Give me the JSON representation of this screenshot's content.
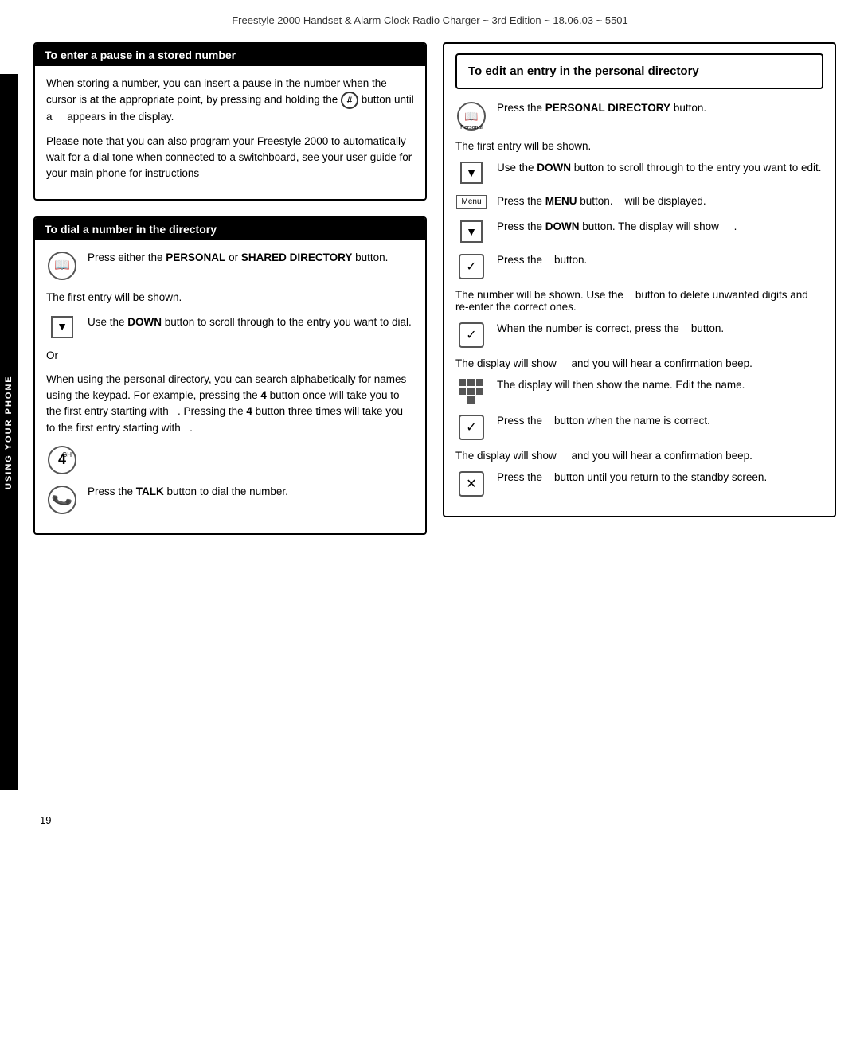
{
  "header": {
    "title": "Freestyle 2000 Handset & Alarm Clock Radio Charger  ~ 3rd Edition ~ 18.06.03 ~ 5501"
  },
  "sidebar": {
    "label": "USING YOUR PHONE"
  },
  "left": {
    "section1": {
      "title": "To enter a pause in a stored number",
      "paragraphs": [
        "When storing a number, you can insert a pause in the number when the cursor is at the appropriate point, by pressing and holding the",
        "button until a    appears in the display.",
        "Please note that you can also program your Freestyle 2000 to automatically wait for a dial tone when connected to a switchboard, see your user guide for your main phone for instructions"
      ]
    },
    "section2": {
      "title": "To dial a number in the directory",
      "rows": [
        {
          "icon": "book",
          "text": "Press either the PERSONAL or SHARED DIRECTORY button.",
          "bold_parts": [
            "PERSONAL",
            "SHARED DIRECTORY"
          ]
        },
        {
          "icon": "none",
          "text": "The first entry will be shown."
        },
        {
          "icon": "down",
          "text": "Use the DOWN button to scroll through to the entry you want to dial.",
          "bold_parts": [
            "DOWN"
          ]
        },
        {
          "icon": "none",
          "text": "Or"
        },
        {
          "icon": "none",
          "text": "When using the personal directory, you can search alphabetically for names using the keypad. For example, pressing the 4 button once will take you to the first entry starting with .  Pressing the 4 button three times will take you to the first entry starting with  .",
          "bold_parts": [
            "4",
            "4"
          ]
        },
        {
          "icon": "4",
          "text": ""
        },
        {
          "icon": "talk",
          "text": "Press the TALK button to dial the number.",
          "bold_parts": [
            "TALK"
          ]
        }
      ]
    }
  },
  "right": {
    "section": {
      "title": "To edit an entry in the personal directory",
      "rows": [
        {
          "icon": "book",
          "text": "Press the PERSONAL DIRECTORY button.",
          "bold": "PERSONAL DIRECTORY"
        },
        {
          "icon": "none",
          "text": "The first entry will be shown."
        },
        {
          "icon": "down",
          "text": "Use the DOWN button to scroll through to the entry you want to edit.",
          "bold": "DOWN"
        },
        {
          "icon": "menu",
          "text": "Press the MENU button.    will be displayed.",
          "bold": "MENU"
        },
        {
          "icon": "down",
          "text": "Press the DOWN button. The display will show    .",
          "bold": "DOWN"
        },
        {
          "icon": "check",
          "text": "Press the    button."
        },
        {
          "icon": "none",
          "text": "The number will be shown. Use the    button to delete unwanted digits and re-enter the correct ones."
        },
        {
          "icon": "check",
          "text": "When the number is correct, press the    button."
        },
        {
          "icon": "none",
          "text": "The display will show    and you will hear a confirmation beep."
        },
        {
          "icon": "grid",
          "text": "The display will then show the name. Edit the name."
        },
        {
          "icon": "check",
          "text": "Press the    button when the name is correct."
        },
        {
          "icon": "none",
          "text": "The display will show    and you will hear a confirmation beep."
        },
        {
          "icon": "x",
          "text": "Press the    button until you return to the standby screen."
        }
      ]
    }
  },
  "page_number": "19"
}
